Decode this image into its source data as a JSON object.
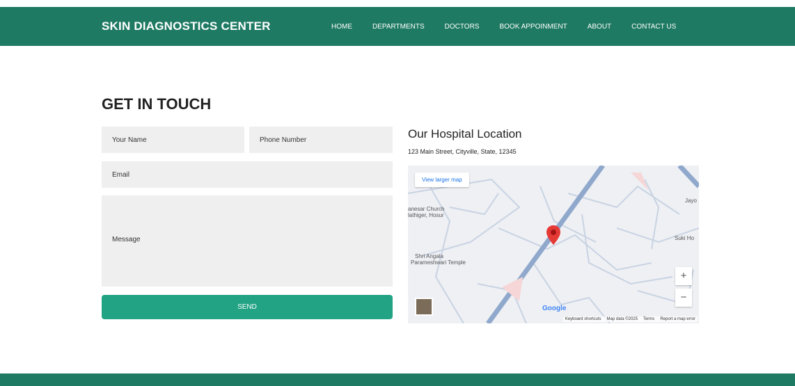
{
  "header": {
    "brand": "SKIN DIAGNOSTICS CENTER",
    "nav": [
      "HOME",
      "DEPARTMENTS",
      "DOCTORS",
      "BOOK APPOINMENT",
      "ABOUT",
      "CONTACT US"
    ]
  },
  "contact": {
    "title": "GET IN TOUCH",
    "name_placeholder": "Your Name",
    "phone_placeholder": "Phone Number",
    "email_placeholder": "Email",
    "message_placeholder": "Message",
    "send_label": "SEND"
  },
  "location": {
    "title": "Our Hospital Location",
    "address": "123 Main Street, Cityville, State, 12345"
  },
  "map": {
    "larger_map": "View larger map",
    "labels": [
      "anesar Church",
      "lathiger, Hosur",
      "Shri Angala",
      "Parameshwari Temple",
      "Jayo",
      "Suki Ho"
    ],
    "zoom_in": "+",
    "zoom_out": "−",
    "google": "Google",
    "footer": [
      "Keyboard shortcuts",
      "Map data ©2025",
      "Terms",
      "Report a map error"
    ],
    "colors": {
      "road_major": "#8fa8cc",
      "road_minor": "#c9d3e2",
      "pin": "#e53935"
    }
  },
  "colors": {
    "header": "#1f7a63",
    "send_button": "#22a383",
    "field_bg": "#efefef"
  }
}
